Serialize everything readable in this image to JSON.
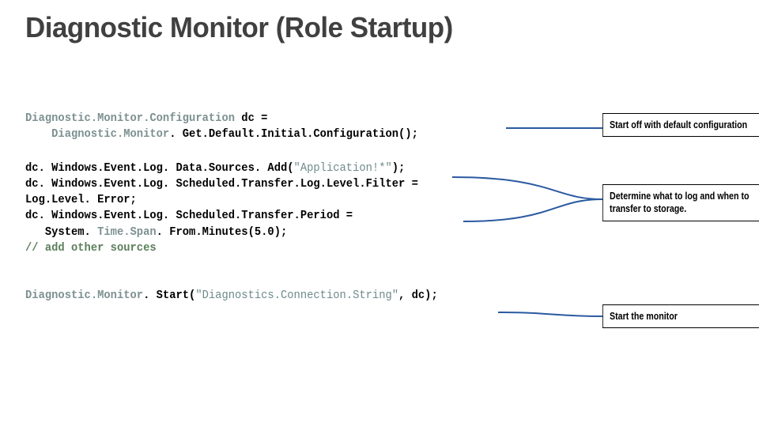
{
  "title": "Diagnostic Monitor (Role Startup)",
  "code": {
    "block1": {
      "type1": "Diagnostic.Monitor.Configuration",
      "mid1": " dc =",
      "indent": "    ",
      "type2": "Diagnostic.Monitor",
      "tail2": ". Get.Default.Initial.Configuration();"
    },
    "block2": {
      "l1a": "dc. Windows.Event.Log. Data.Sources. Add(",
      "l1s": "\"Application!*\"",
      "l1b": ");",
      "l2": "dc. Windows.Event.Log. Scheduled.Transfer.Log.Level.Filter =",
      "l3": "Log.Level. Error;",
      "l4": "dc. Windows.Event.Log. Scheduled.Transfer.Period =",
      "l5a": "   System. ",
      "l5t": "Time.Span",
      "l5b": ". From.Minutes(5.0);",
      "l6": "// add other sources"
    },
    "block3": {
      "type": "Diagnostic.Monitor",
      "mid": ". Start(",
      "str": "\"Diagnostics.Connection.String\"",
      "tail": ", dc);"
    }
  },
  "callouts": {
    "c1": "Start off with default configuration",
    "c2": "Determine what to log and when to transfer to storage.",
    "c3": "Start the monitor"
  }
}
